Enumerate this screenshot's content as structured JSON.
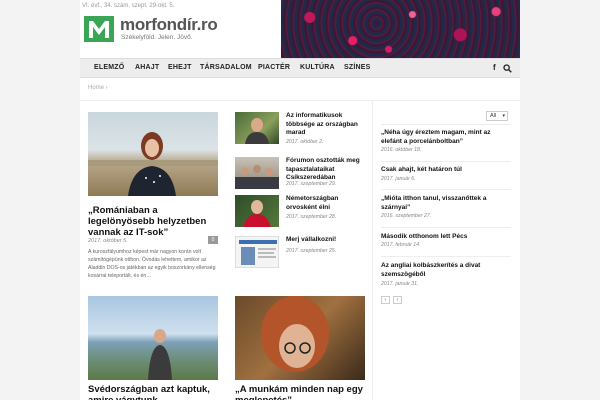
{
  "header": {
    "issue": "VI. évf., 34. szám, szept. 29-okt. 5.",
    "logo_name": "morfondír.ro",
    "logo_tagline": "Székelyföld. Jelen. Jövő."
  },
  "nav": {
    "items": [
      "ELEMZŐ",
      "AHAJT",
      "EHEJT",
      "TÁRSADALOM",
      "PIACTÉR",
      "KULTÚRA",
      "SZÍNES"
    ],
    "facebook_glyph": "f",
    "icons": [
      "facebook-icon",
      "search-icon"
    ]
  },
  "breadcrumb": "Home",
  "featured": {
    "title": "„Romániaban a legelönyösebb helyzetben vannak az IT-sok”",
    "date": "2017. október 5.",
    "badge": "0",
    "excerpt": "A kuroszfályumhoz képest már nagyon korán volt számítógépünk otthon. Óvodás lehettem, amikor az Aladdin DOS-os játékban az egyik boszorkány ellenség kosárral teleportált, és én…"
  },
  "small_list": [
    {
      "title": "Az informatikusok többsége az országban marad",
      "date": "2017. október 2."
    },
    {
      "title": "Fórumon osztották meg tapasztalataikat Csíkszeredában",
      "date": "2017. szeptember 29."
    },
    {
      "title": "Németországban orvosként élni",
      "date": "2017. szeptember 28."
    },
    {
      "title": "Merj vállalkozni!",
      "date": "2017. szeptember 25."
    }
  ],
  "bottom_articles": [
    {
      "title": "Svédországban azt kaptuk, amire vágytunk"
    },
    {
      "title": "„A munkám minden nap egy meglepetés”"
    }
  ],
  "sidebar": {
    "filter": "All",
    "items": [
      {
        "title": "„Néha úgy éreztem magam, mint az elefánt a porcelánboltban”",
        "date": "2016. október 18."
      },
      {
        "title": "Csak ahajt, két határon túl",
        "date": "2017. január 6."
      },
      {
        "title": "„Mióta itthon tanul, visszanőttek a szárnyai”",
        "date": "2016. szeptember 27."
      },
      {
        "title": "Második otthonom lett Pécs",
        "date": "2017. február 14."
      },
      {
        "title": "Az angliai kolbászkerítés a divat szemszögéből",
        "date": "2017. január 31."
      }
    ],
    "prev": "‹",
    "next": "›"
  },
  "colors": {
    "logo_green": "#3aa655",
    "accent": "#c2185b"
  }
}
